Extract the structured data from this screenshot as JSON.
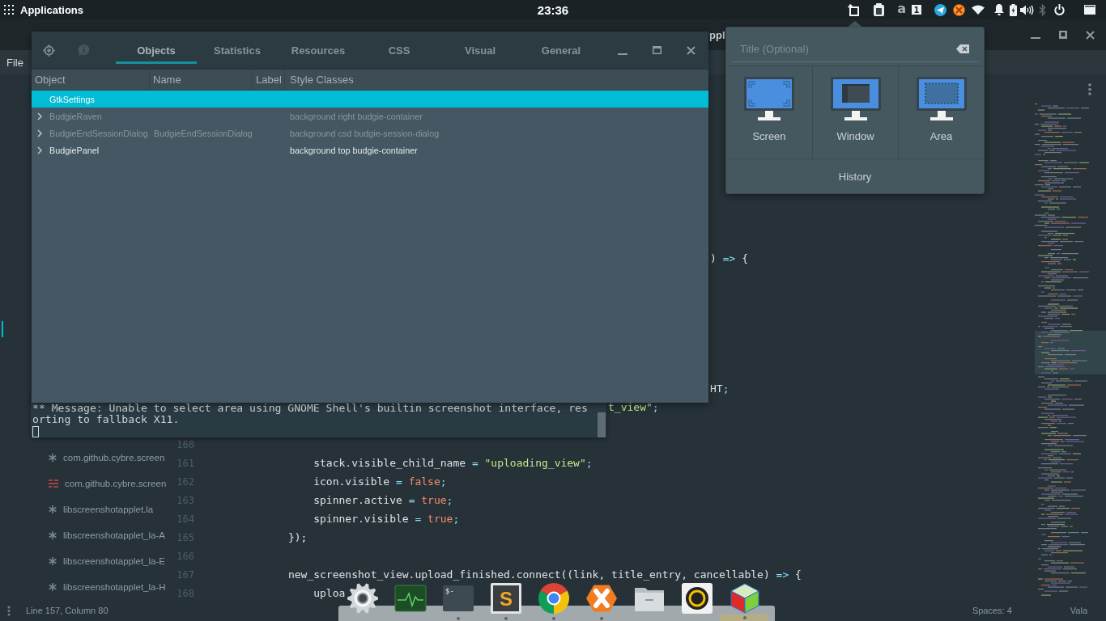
{
  "top_panel": {
    "menu_label": "Applications",
    "clock": "23:36",
    "tray": {
      "letter": "a",
      "badge": "1",
      "bluetooth_on": false
    }
  },
  "editor": {
    "title": "ppl",
    "menu": [
      "File"
    ],
    "files": [
      {
        "name": "com.github.cybre.screen",
        "kind": "generic"
      },
      {
        "name": "com.github.cybre.screen",
        "kind": "text"
      },
      {
        "name": "libscreenshotapplet.la",
        "kind": "generic"
      },
      {
        "name": "libscreenshotapplet_la-A",
        "kind": "generic"
      },
      {
        "name": "libscreenshotapplet_la-E",
        "kind": "generic"
      },
      {
        "name": "libscreenshotapplet_la-H",
        "kind": "generic"
      }
    ],
    "lines": [
      {
        "tokens": [
          {
            "text": ") ",
            "kind": "plain"
          },
          {
            "text": "=>",
            "kind": "operator"
          },
          {
            "text": " {",
            "kind": "plain"
          }
        ]
      },
      {
        "tokens": [
          {
            "text": "HT",
            "kind": "plain"
          },
          {
            "text": ";",
            "kind": "operator"
          }
        ]
      },
      {
        "tokens": [
          {
            "text": "t_view\"",
            "kind": "string"
          },
          {
            "text": ";",
            "kind": "operator"
          }
        ]
      },
      {
        "number": "160"
      },
      {
        "number": "161",
        "tokens": [
          {
            "text": "                stack.visible_child_name ",
            "kind": "plain"
          },
          {
            "text": "= ",
            "kind": "operator"
          },
          {
            "text": "\"uploading_view\"",
            "kind": "string"
          },
          {
            "text": ";",
            "kind": "operator"
          }
        ]
      },
      {
        "number": "162",
        "tokens": [
          {
            "text": "                icon.visible ",
            "kind": "plain"
          },
          {
            "text": "= ",
            "kind": "operator"
          },
          {
            "text": "false",
            "kind": "keyword"
          },
          {
            "text": ";",
            "kind": "operator"
          }
        ]
      },
      {
        "number": "163",
        "tokens": [
          {
            "text": "                spinner.active ",
            "kind": "plain"
          },
          {
            "text": "= ",
            "kind": "operator"
          },
          {
            "text": "true",
            "kind": "keyword"
          },
          {
            "text": ";",
            "kind": "operator"
          }
        ]
      },
      {
        "number": "164",
        "tokens": [
          {
            "text": "                spinner.visible ",
            "kind": "plain"
          },
          {
            "text": "= ",
            "kind": "operator"
          },
          {
            "text": "true",
            "kind": "keyword"
          },
          {
            "text": ";",
            "kind": "operator"
          }
        ]
      },
      {
        "number": "165",
        "tokens": [
          {
            "text": "            });",
            "kind": "plain"
          }
        ]
      },
      {
        "number": "166"
      },
      {
        "number": "167",
        "tokens": [
          {
            "text": "            new_screenshot_view.upload_finished.connect((link, title_entry, cancellable) ",
            "kind": "plain"
          },
          {
            "text": "=>",
            "kind": "operator"
          },
          {
            "text": " {",
            "kind": "plain"
          }
        ]
      },
      {
        "number": "168",
        "tokens": [
          {
            "text": "                uploa",
            "kind": "plain"
          }
        ]
      }
    ],
    "status_bar": {
      "position": "Line 157, Column 80",
      "indentation": "Spaces: 4",
      "language": "Vala"
    }
  },
  "terminal": {
    "output_lines": [
      "** Message: Unable to select area using GNOME Shell's builtin screenshot interface, res",
      "orting to fallback X11."
    ]
  },
  "inspector": {
    "tabs": [
      {
        "label": "Objects",
        "selected": true
      },
      {
        "label": "Statistics",
        "selected": false
      },
      {
        "label": "Resources",
        "selected": false
      },
      {
        "label": "CSS",
        "selected": false
      },
      {
        "label": "Visual",
        "selected": false
      },
      {
        "label": "General",
        "selected": false
      }
    ],
    "columns": [
      "Object",
      "Name",
      "Label",
      "Style Classes"
    ],
    "rows": [
      {
        "object": "GtkSettings",
        "selected": true,
        "dimmed": false,
        "has_children": false
      },
      {
        "object": "BudgieRaven",
        "style_classes": "background right budgie-container",
        "selected": false,
        "dimmed": true,
        "has_children": true
      },
      {
        "object": "BudgieEndSessionDialog",
        "name": "BudgieEndSessionDialog",
        "style_classes": "background csd budgie-session-dialog",
        "selected": false,
        "dimmed": true,
        "has_children": true
      },
      {
        "object": "BudgiePanel",
        "style_classes": "background top budgie-container",
        "selected": false,
        "dimmed": false,
        "has_children": true
      }
    ]
  },
  "screenshot_popover": {
    "title_field": {
      "placeholder": "Title (Optional)"
    },
    "modes": [
      {
        "kind": "screen",
        "label": "Screen"
      },
      {
        "kind": "window",
        "label": "Window"
      },
      {
        "kind": "area",
        "label": "Area"
      }
    ],
    "history": "History"
  },
  "dock": {
    "items": [
      {
        "kind": "gear",
        "running": false,
        "active": false
      },
      {
        "kind": "graph",
        "running": false,
        "active": false
      },
      {
        "kind": "terminal",
        "glyph": "$-",
        "running": true,
        "active": false
      },
      {
        "kind": "letter",
        "glyph": "S",
        "running": true,
        "active": false
      },
      {
        "kind": "wheel",
        "running": true,
        "active": false
      },
      {
        "kind": "hexagon",
        "running": true,
        "active": false
      },
      {
        "kind": "folder",
        "running": false,
        "active": false
      },
      {
        "kind": "disc",
        "running": false,
        "active": false
      },
      {
        "kind": "cube",
        "running": true,
        "active": true
      }
    ]
  }
}
